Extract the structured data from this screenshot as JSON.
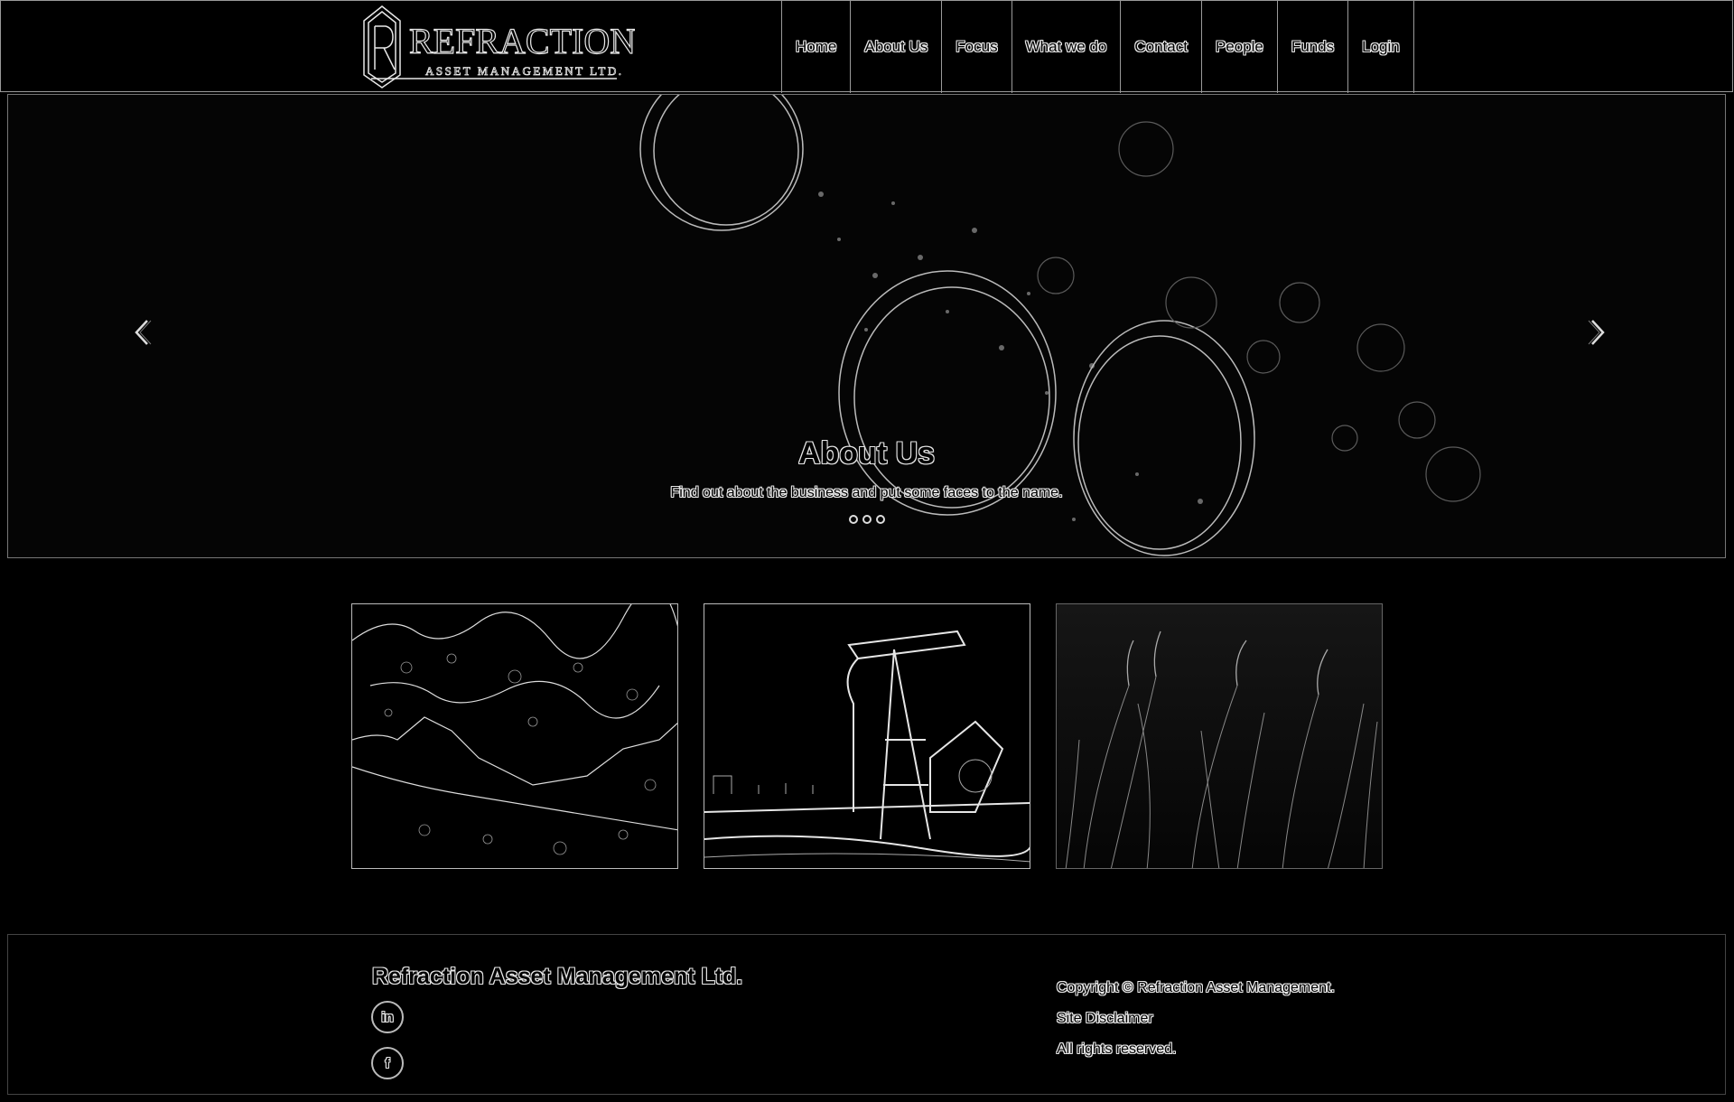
{
  "header": {
    "logo": {
      "name": "REFRACTION",
      "tagline": "ASSET MANAGEMENT LTD.",
      "monogram": "R"
    },
    "nav": [
      {
        "label": "Home"
      },
      {
        "label": "About Us"
      },
      {
        "label": "Focus"
      },
      {
        "label": "What we do"
      },
      {
        "label": "Contact"
      },
      {
        "label": "People"
      },
      {
        "label": "Funds"
      },
      {
        "label": "Login"
      }
    ]
  },
  "hero": {
    "title": "About Us",
    "subtitle": "Find out about the business and put some faces to the name.",
    "slides_count": 3,
    "prev_icon": "chevron-left-icon",
    "next_icon": "chevron-right-icon"
  },
  "features": [
    {
      "image": "rock-texture-image"
    },
    {
      "image": "oil-pumpjack-image"
    },
    {
      "image": "wheat-field-image"
    }
  ],
  "footer": {
    "company": "Refraction Asset Management Ltd.",
    "social": [
      {
        "icon": "linkedin-icon",
        "glyph": "in"
      },
      {
        "icon": "facebook-icon",
        "glyph": "f"
      }
    ],
    "copyright": "Copyright © Refraction Asset Management.",
    "disclaimer": "Site Disclaimer",
    "rights": "All rights reserved."
  },
  "colors": {
    "background": "#000000",
    "edge": "#e8e8e8",
    "border": "#9a9a9a"
  }
}
